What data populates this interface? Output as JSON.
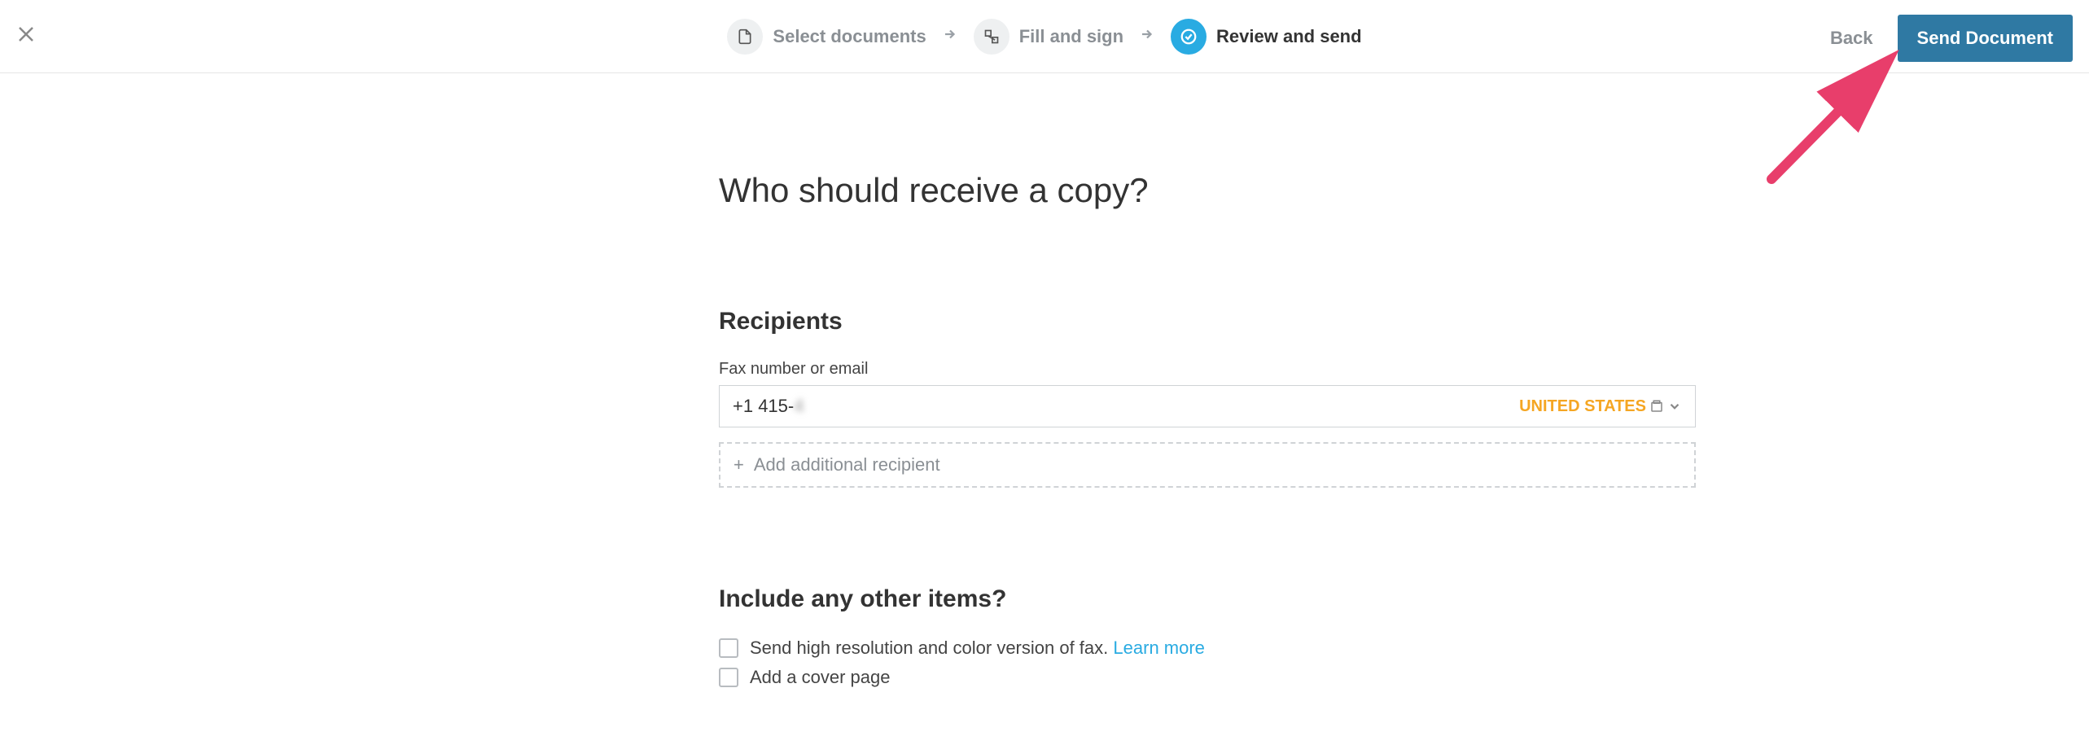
{
  "header": {
    "steps": [
      {
        "label": "Select documents",
        "icon": "document-icon",
        "active": false
      },
      {
        "label": "Fill and sign",
        "icon": "sign-icon",
        "active": false
      },
      {
        "label": "Review and send",
        "icon": "check-icon",
        "active": true
      }
    ],
    "back_label": "Back",
    "send_label": "Send Document"
  },
  "main": {
    "title": "Who should receive a copy?",
    "recipients_heading": "Recipients",
    "fax_label": "Fax number or email",
    "fax_value_prefix": "+1 415-",
    "fax_value_hidden": "4    ",
    "country_label": "UNITED STATES",
    "add_recipient_label": "Add additional recipient",
    "other_items_heading": "Include any other items?",
    "checkbox_high_res": "Send high resolution and color version of fax.",
    "learn_more": "Learn more",
    "checkbox_cover": "Add a cover page"
  }
}
